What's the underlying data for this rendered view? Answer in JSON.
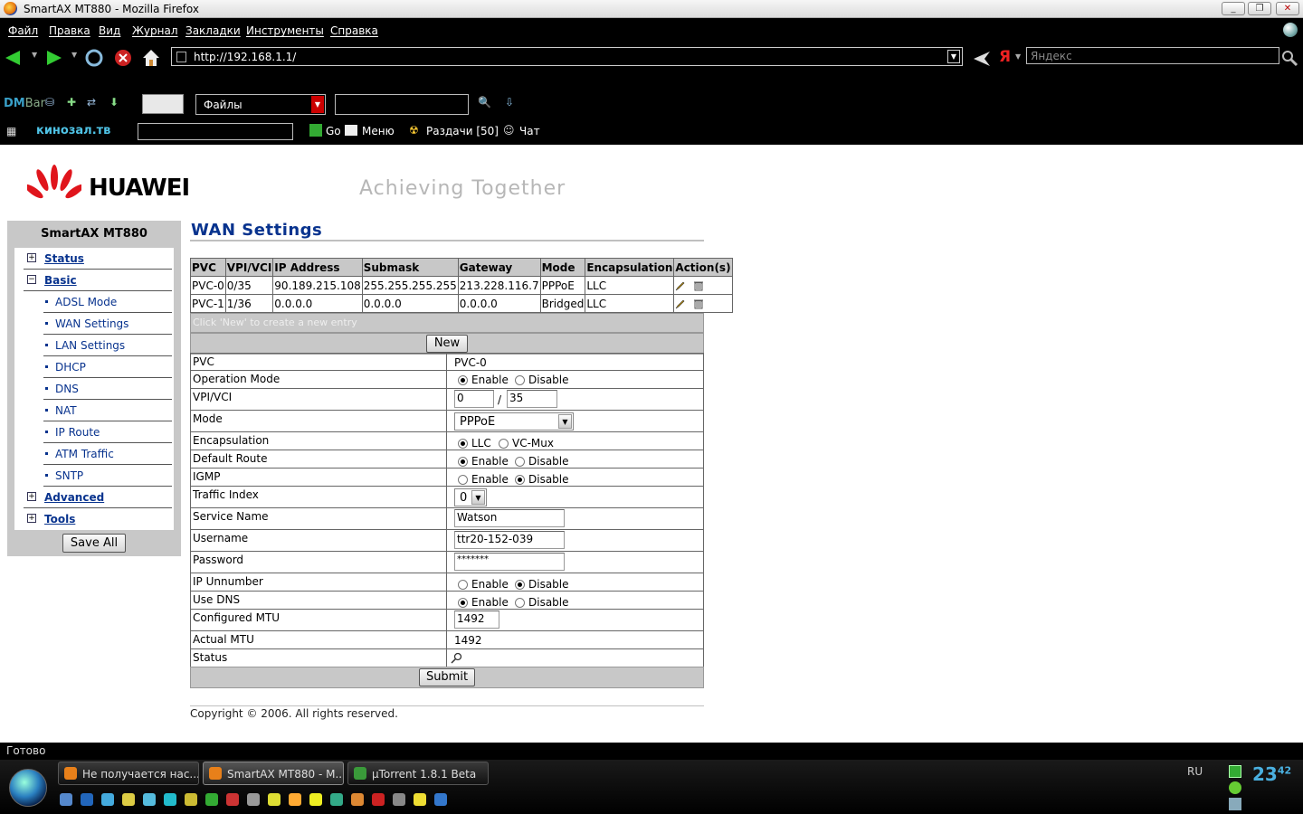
{
  "window": {
    "title": "SmartAX MT880 - Mozilla Firefox"
  },
  "menu": [
    "Файл",
    "Правка",
    "Вид",
    "Журнал",
    "Закладки",
    "Инструменты",
    "Справка"
  ],
  "nav": {
    "url": "http://192.168.1.1/",
    "search_placeholder": "Яндекс"
  },
  "dmbar": {
    "logo_a": "DM",
    "logo_b": "Bar",
    "select_value": "Файлы"
  },
  "kzbar": {
    "logo": "кинозал.тв",
    "go": "Go",
    "menu": "Меню",
    "razdachi": "Раздачи [50]",
    "chat": "Чат"
  },
  "page": {
    "brand": "HUAWEI",
    "slogan": "Achieving Together",
    "device": "SmartAX MT880",
    "title": "WAN Settings",
    "save_all": "Save All",
    "new_btn": "New",
    "hint": "Click 'New' to create a new entry",
    "submit": "Submit",
    "copyright": "Copyright © 2006. All rights reserved."
  },
  "sidebar": {
    "groups": [
      {
        "expander": "+",
        "label": "Status"
      },
      {
        "expander": "−",
        "label": "Basic"
      },
      {
        "expander": "+",
        "label": "Advanced"
      },
      {
        "expander": "+",
        "label": "Tools"
      }
    ],
    "basic_items": [
      "ADSL Mode",
      "WAN Settings",
      "LAN Settings",
      "DHCP",
      "DNS",
      "NAT",
      "IP Route",
      "ATM Traffic",
      "SNTP"
    ]
  },
  "pvc_table": {
    "headers": [
      "PVC",
      "VPI/VCI",
      "IP Address",
      "Submask",
      "Gateway",
      "Mode",
      "Encapsulation",
      "Action(s)"
    ],
    "rows": [
      [
        "PVC-0",
        "0/35",
        "90.189.215.108",
        "255.255.255.255",
        "213.228.116.7",
        "PPPoE",
        "LLC"
      ],
      [
        "PVC-1",
        "1/36",
        "0.0.0.0",
        "0.0.0.0",
        "0.0.0.0",
        "Bridged",
        "LLC"
      ]
    ]
  },
  "form": {
    "pvc_label": "PVC",
    "pvc_value": "PVC-0",
    "opmode_label": "Operation Mode",
    "vpivci_label": "VPI/VCI",
    "vpi": "0",
    "vci": "35",
    "slash": "/",
    "mode_label": "Mode",
    "mode_value": "PPPoE",
    "encap_label": "Encapsulation",
    "llc": "LLC",
    "vcmux": "VC-Mux",
    "defroute_label": "Default Route",
    "igmp_label": "IGMP",
    "traffic_label": "Traffic Index",
    "traffic_value": "0",
    "service_label": "Service Name",
    "service_value": "Watson",
    "username_label": "Username",
    "username_value": "ttr20-152-039",
    "password_label": "Password",
    "password_value": "*******",
    "ipunnum_label": "IP Unnumber",
    "usedns_label": "Use DNS",
    "mtu_label": "Configured MTU",
    "mtu_value": "1492",
    "actual_mtu_label": "Actual MTU",
    "actual_mtu_value": "1492",
    "status_label": "Status",
    "enable": "Enable",
    "disable": "Disable"
  },
  "statusbar": {
    "text": "Готово"
  },
  "taskbar": {
    "buttons": [
      "Не получается нас...",
      "SmartAX MT880 - M...",
      "µTorrent 1.8.1 Beta"
    ],
    "lang": "RU",
    "clock_h": "23",
    "clock_m": "42"
  }
}
